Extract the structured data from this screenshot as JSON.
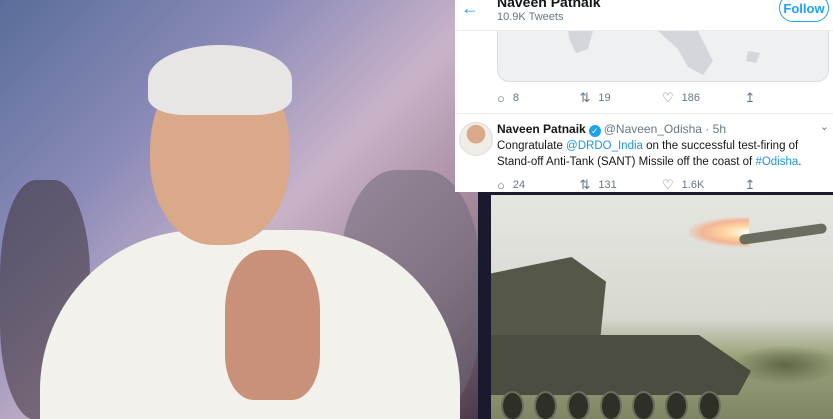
{
  "profile_header": {
    "back_icon": "arrow-left-icon",
    "name": "Naveen Patnaik",
    "tweet_count": "10.9K Tweets",
    "follow_label": "Follow"
  },
  "tweet_1": {
    "replies": "8",
    "retweets": "19",
    "likes": "186"
  },
  "tweet_2": {
    "name": "Naveen Patnaik",
    "handle": "@Naveen_Odisha",
    "time": "5h",
    "text_1": "Congratulate ",
    "mention": "@DRDO_India",
    "text_2": " on the successful test-firing of Stand-off Anti-Tank (SANT) Missile off the coast of ",
    "hashtag": "#Odisha",
    "text_3": ".",
    "replies": "24",
    "retweets": "131",
    "likes": "1.6K"
  },
  "icons": {
    "reply": "reply-icon",
    "retweet": "retweet-icon",
    "like": "heart-icon",
    "share": "share-icon",
    "verified": "verified-badge-icon",
    "caret": "chevron-down-icon"
  },
  "colors": {
    "twitter_blue": "#1da1f2",
    "link_blue": "#1b95e0",
    "text_dark": "#14171a",
    "text_gray": "#657786"
  }
}
